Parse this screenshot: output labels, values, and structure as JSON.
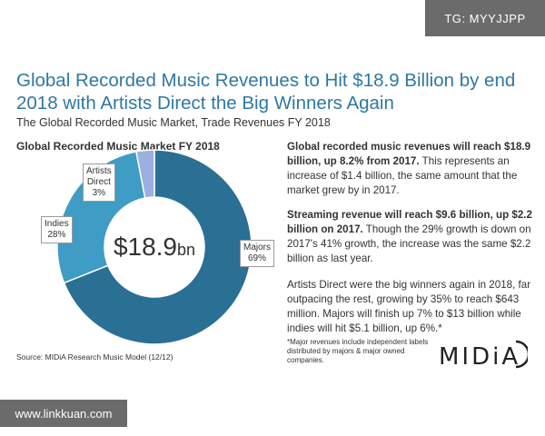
{
  "watermark_top": "TG: MYYJJPP",
  "watermark_bottom": "www.linkkuan.com",
  "title": "Global Recorded Music Revenues to Hit $18.9 Billion by end 2018 with Artists Direct the Big Winners Again",
  "subtitle": "The Global Recorded Music Market, Trade Revenues FY 2018",
  "chart_data": {
    "type": "pie",
    "title": "Global Recorded Music Market FY 2018",
    "center_value": "$18.9",
    "center_unit": "bn",
    "slices": [
      {
        "name": "Majors",
        "percent_label": "69%",
        "value": 69,
        "color": "#2a6f94"
      },
      {
        "name": "Indies",
        "percent_label": "28%",
        "value": 28,
        "color": "#3f9cc5"
      },
      {
        "name": "Artists Direct",
        "percent_label": "3%",
        "value": 3,
        "color": "#9bb0e0"
      }
    ]
  },
  "labels": {
    "majors": {
      "line1": "Majors",
      "line2": "69%"
    },
    "indies": {
      "line1": "Indies",
      "line2": "28%"
    },
    "artists": {
      "line1": "Artists",
      "line2": "Direct",
      "line3": "3%"
    }
  },
  "source": "Source: MIDiA Research Music Model (12/12)",
  "para1": {
    "bold": "Global recorded music revenues will reach $18.9 billion, up 8.2% from 2017.",
    "rest": " This represents an increase of $1.4 billion, the same amount that the market grew by in 2017."
  },
  "para2": {
    "bold": "Streaming revenue will reach $9.6 billion, up $2.2 billion on 2017.",
    "rest": " Though the 29% growth is down on 2017's 41% growth, the increase was the same $2.2 billion as last year."
  },
  "para3": "Artists Direct were the big winners again in 2018, far outpacing the rest, growing by 35% to reach $643 million. Majors will finish up 7% to $13 billion while indies will hit $5.1 billion, up 6%.*",
  "footnote": "*Major revenues include independent labels distributed by majors & major owned companies.",
  "logo": "MIDiA"
}
